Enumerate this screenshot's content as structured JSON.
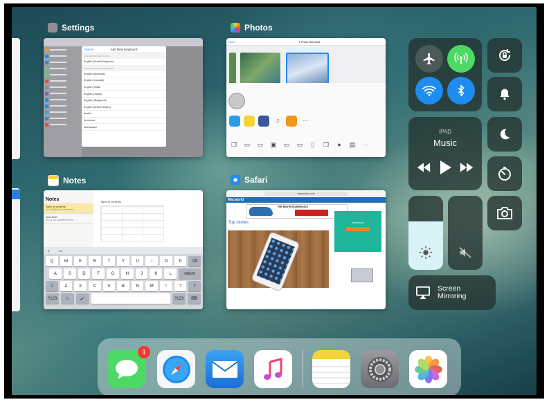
{
  "apps": {
    "settings": {
      "label": "Settings",
      "modal_title": "Add New Keyboard",
      "cancel": "Cancel",
      "suggested_header": "SUGGESTED KEYBOARDS",
      "other_header": "OTHER IPHONE KEYBOARDS",
      "suggested": [
        "English (United Kingdom)"
      ],
      "languages": [
        "English (Australia)",
        "English (Canada)",
        "English (India)",
        "English (Japan)",
        "English (Singapore)",
        "English (United States)",
        "Arabic",
        "Armenian",
        "Azerbaijani"
      ]
    },
    "photos": {
      "label": "Photos",
      "done": "Done",
      "selected": "1 Photo Selected"
    },
    "notes": {
      "label": "Notes",
      "heading": "Notes",
      "items": [
        {
          "title": "Table of contents",
          "sub": "10:16  Table of contents"
        },
        {
          "title": "New Note",
          "sub": "10:21  No additional text"
        }
      ],
      "table_title": "Table of contents",
      "kb_rows": [
        [
          "Q",
          "W",
          "E",
          "R",
          "T",
          "Y",
          "U",
          "I",
          "O",
          "P",
          "⌫"
        ],
        [
          "A",
          "S",
          "D",
          "F",
          "G",
          "H",
          "J",
          "K",
          "L",
          "return"
        ],
        [
          "⇧",
          "Z",
          "X",
          "C",
          "V",
          "B",
          "N",
          "M",
          "!",
          "?",
          "⇧"
        ]
      ],
      "kb_bottom": [
        "?123",
        "☺",
        "🎤",
        "",
        "?123",
        "⌨"
      ]
    },
    "safari": {
      "label": "Safari",
      "url": "macworld.co.uk",
      "site_logo": "Macworld",
      "ad_text": "THE NEW MITSUBISHI ASX",
      "top_stories": "Top stories",
      "promo_text": "freshstock"
    }
  },
  "control_center": {
    "music_sub": "IPAD",
    "music_title": "Music",
    "brightness": 0.65,
    "volume": 0,
    "screen_mirroring": "Screen\nMirroring",
    "icons": [
      "airplane-icon",
      "cellular-icon",
      "wifi-icon",
      "bluetooth-icon",
      "orientation-lock-icon",
      "bell-icon",
      "moon-icon",
      "timer-icon",
      "camera-icon",
      "brightness-icon",
      "mute-icon",
      "airplay-icon"
    ],
    "colors": {
      "airplane_off": "#4a5a58",
      "cellular_on": "#4cd964",
      "wifi_on": "#1e8cf0",
      "bluetooth_on": "#1e8cf0"
    }
  },
  "dock": {
    "messages_badge": "1",
    "apps": [
      "messages",
      "safari",
      "mail",
      "music",
      "notes",
      "settings",
      "photos"
    ]
  }
}
